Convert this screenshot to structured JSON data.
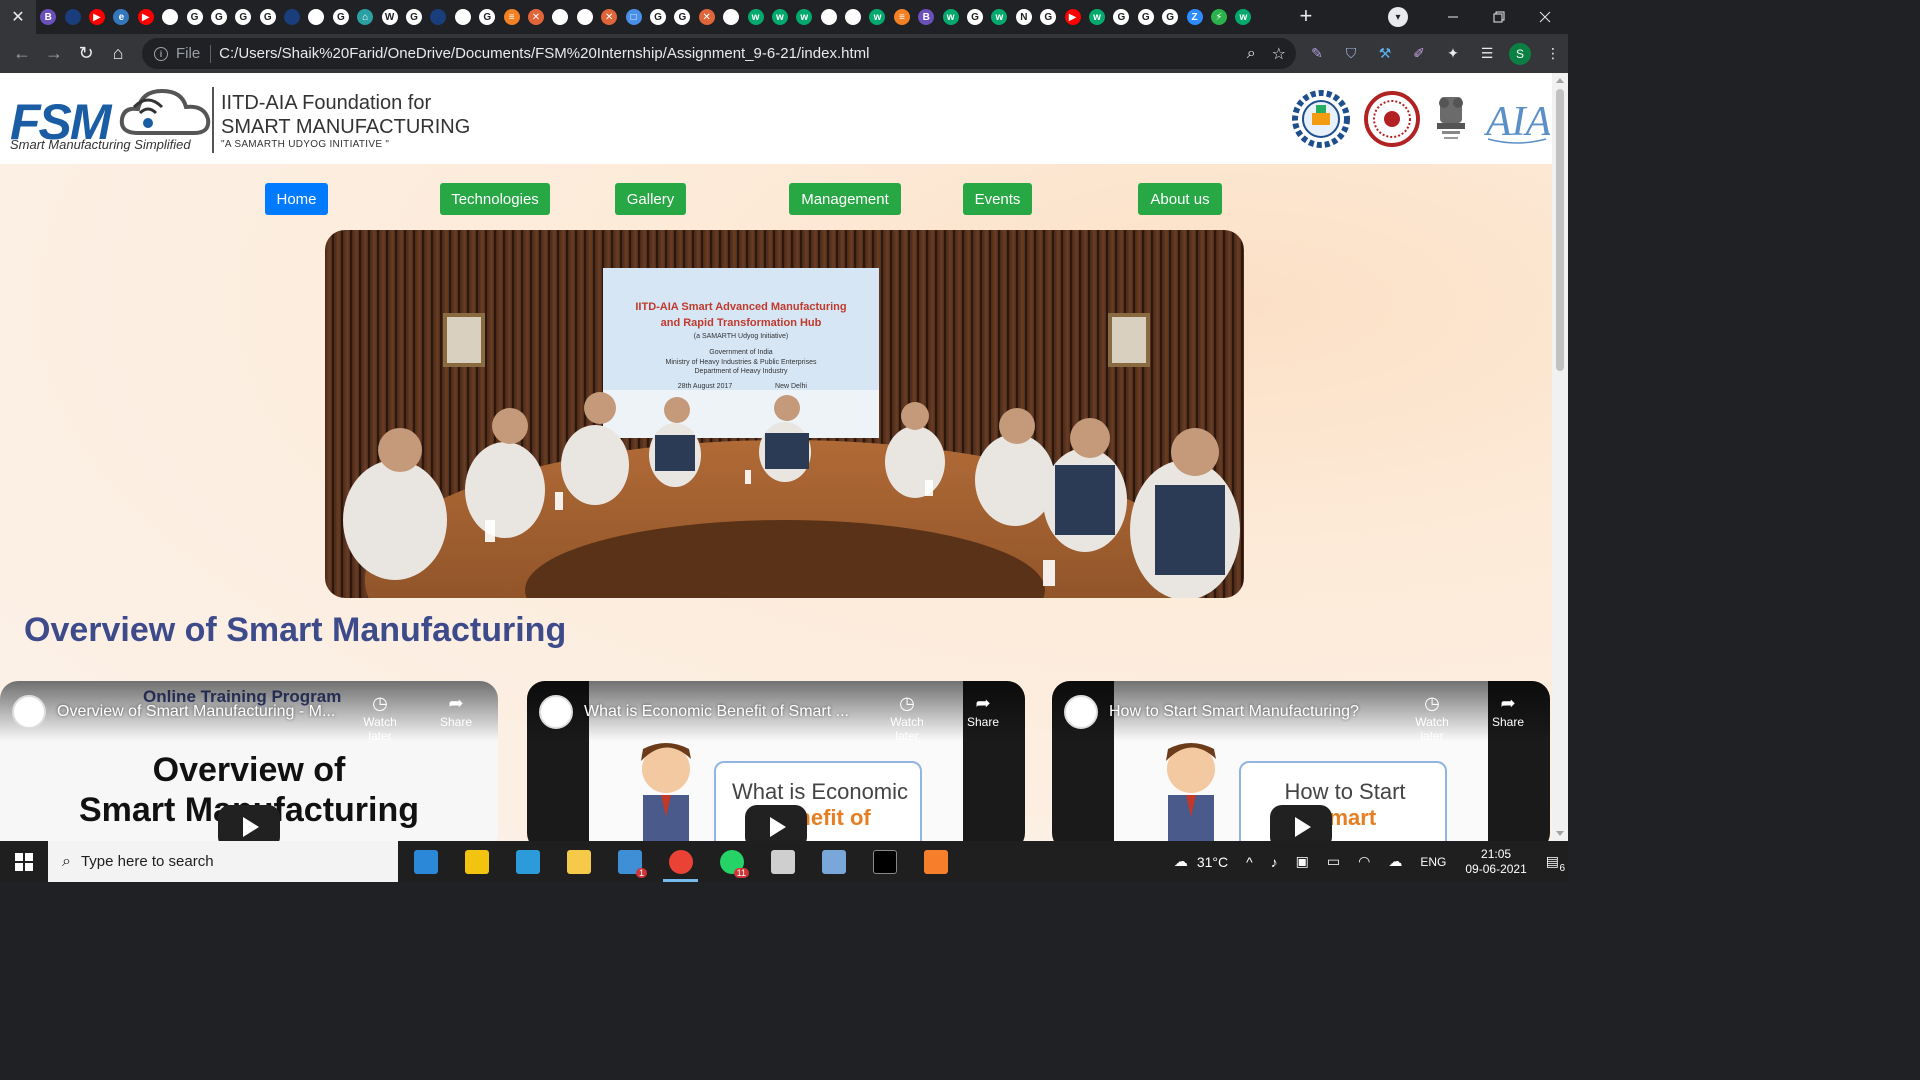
{
  "browser": {
    "tab_close_glyph": "✕",
    "new_tab_glyph": "+",
    "favicons": [
      {
        "name": "bing-favicon",
        "color": "#6b4fbb",
        "letter": "B"
      },
      {
        "name": "site-favicon",
        "color": "#1a3d7c",
        "letter": ""
      },
      {
        "name": "youtube-favicon",
        "color": "#ff0000",
        "letter": "▶"
      },
      {
        "name": "edge-favicon",
        "color": "#3277bc",
        "letter": "e"
      },
      {
        "name": "youtube-favicon",
        "color": "#ff0000",
        "letter": "▶"
      },
      {
        "name": "github-favicon",
        "color": "#ffffff",
        "letter": ""
      },
      {
        "name": "google-favicon",
        "color": "#ffffff",
        "letter": "G"
      },
      {
        "name": "google-favicon",
        "color": "#ffffff",
        "letter": "G"
      },
      {
        "name": "google-favicon",
        "color": "#ffffff",
        "letter": "G"
      },
      {
        "name": "google-favicon",
        "color": "#ffffff",
        "letter": "G"
      },
      {
        "name": "site-favicon",
        "color": "#1a3d7c",
        "letter": ""
      },
      {
        "name": "github-favicon",
        "color": "#ffffff",
        "letter": ""
      },
      {
        "name": "google-favicon",
        "color": "#ffffff",
        "letter": "G"
      },
      {
        "name": "bank-favicon",
        "color": "#2aa0a4",
        "letter": "⌂"
      },
      {
        "name": "wordpress-favicon",
        "color": "#ffffff",
        "letter": "W"
      },
      {
        "name": "google-favicon",
        "color": "#ffffff",
        "letter": "G"
      },
      {
        "name": "site-favicon",
        "color": "#1a3d7c",
        "letter": ""
      },
      {
        "name": "github-favicon",
        "color": "#ffffff",
        "letter": ""
      },
      {
        "name": "google-favicon",
        "color": "#ffffff",
        "letter": "G"
      },
      {
        "name": "stackoverflow-favicon",
        "color": "#f48024",
        "letter": "≡"
      },
      {
        "name": "tools-favicon",
        "color": "#e0663a",
        "letter": "✕"
      },
      {
        "name": "github-favicon",
        "color": "#ffffff",
        "letter": ""
      },
      {
        "name": "github-favicon",
        "color": "#ffffff",
        "letter": ""
      },
      {
        "name": "tools-favicon",
        "color": "#e0663a",
        "letter": "✕"
      },
      {
        "name": "site-favicon",
        "color": "#4a8fe7",
        "letter": "□"
      },
      {
        "name": "google-favicon",
        "color": "#ffffff",
        "letter": "G"
      },
      {
        "name": "google-favicon",
        "color": "#ffffff",
        "letter": "G"
      },
      {
        "name": "tools-favicon",
        "color": "#e0663a",
        "letter": "✕"
      },
      {
        "name": "github-favicon",
        "color": "#ffffff",
        "letter": ""
      },
      {
        "name": "w3schools-favicon",
        "color": "#04aa6d",
        "letter": "w"
      },
      {
        "name": "w3schools-favicon",
        "color": "#04aa6d",
        "letter": "w"
      },
      {
        "name": "w3schools-favicon",
        "color": "#04aa6d",
        "letter": "w"
      },
      {
        "name": "github-favicon",
        "color": "#ffffff",
        "letter": ""
      },
      {
        "name": "github-favicon",
        "color": "#ffffff",
        "letter": ""
      },
      {
        "name": "w3schools-favicon",
        "color": "#04aa6d",
        "letter": "w"
      },
      {
        "name": "stackoverflow-favicon",
        "color": "#f48024",
        "letter": "≡"
      },
      {
        "name": "bing-favicon",
        "color": "#6b4fbb",
        "letter": "B"
      },
      {
        "name": "w3schools-favicon",
        "color": "#04aa6d",
        "letter": "w"
      },
      {
        "name": "google-favicon",
        "color": "#ffffff",
        "letter": "G"
      },
      {
        "name": "w3schools-favicon",
        "color": "#04aa6d",
        "letter": "w"
      },
      {
        "name": "notion-favicon",
        "color": "#ffffff",
        "letter": "N"
      },
      {
        "name": "google-favicon",
        "color": "#ffffff",
        "letter": "G"
      },
      {
        "name": "youtube-favicon",
        "color": "#ff0000",
        "letter": "▶"
      },
      {
        "name": "w3schools-favicon",
        "color": "#04aa6d",
        "letter": "w"
      },
      {
        "name": "google-favicon",
        "color": "#ffffff",
        "letter": "G"
      },
      {
        "name": "google-favicon",
        "color": "#ffffff",
        "letter": "G"
      },
      {
        "name": "google-favicon",
        "color": "#ffffff",
        "letter": "G"
      },
      {
        "name": "zoom-favicon",
        "color": "#2d8cff",
        "letter": "Z"
      },
      {
        "name": "site-favicon",
        "color": "#2bb24c",
        "letter": "⚡"
      },
      {
        "name": "w3schools-favicon",
        "color": "#04aa6d",
        "letter": "w"
      },
      {
        "name": "site-favicon",
        "color": "#202124",
        "letter": ""
      }
    ],
    "address": {
      "scheme_label": "File",
      "url": "C:/Users/Shaik%20Farid/OneDrive/Documents/FSM%20Internship/Assignment_9-6-21/index.html"
    },
    "profile_initial": "S"
  },
  "site": {
    "logo_text": "FSM",
    "logo_tagline": "Smart Manufacturing Simplified",
    "foundation_line1": "IITD-AIA Foundation for",
    "foundation_line2": "SMART MANUFACTURING",
    "foundation_line3": "\"A SAMARTH UDYOG INITIATIVE \"",
    "nav": [
      {
        "label": "Home",
        "style": "blue"
      },
      {
        "label": "Technologies",
        "style": "green"
      },
      {
        "label": "Gallery",
        "style": "green"
      },
      {
        "label": "Management",
        "style": "green"
      },
      {
        "label": "Events",
        "style": "green"
      },
      {
        "label": "About us",
        "style": "green"
      }
    ],
    "hero_banner_lines": [
      "IITD-AIA Smart Advanced Manufacturing",
      "and Rapid Transformation Hub",
      "(a SAMARTH Udyog Initiative)",
      "Government of India",
      "Ministry of Heavy Industries & Public Enterprises",
      "Department of Heavy Industry",
      "28th August 2017",
      "New Delhi"
    ],
    "section_title": "Overview of Smart Manufacturing",
    "videos": [
      {
        "title": "Overview of Smart Manufacturing - M...",
        "overlay_top": "Online Training Program",
        "thumb_line1": "Overview of",
        "thumb_line2": "Smart Manufacturing",
        "watch_later": "Watch later",
        "share": "Share"
      },
      {
        "title": "What is Economic Benefit of Smart ...",
        "thumb_line1": "What is Economic",
        "thumb_line2": "Benefit of",
        "watch_later": "Watch later",
        "share": "Share"
      },
      {
        "title": "How to Start Smart Manufacturing?",
        "thumb_line1": "How to Start",
        "thumb_line2": "Smart",
        "watch_later": "Watch later",
        "share": "Share"
      }
    ]
  },
  "taskbar": {
    "search_placeholder": "Type here to search",
    "apps": [
      {
        "name": "edge",
        "color": "#2b88d9",
        "badge": ""
      },
      {
        "name": "store",
        "color": "#f2c40f",
        "badge": ""
      },
      {
        "name": "vscode",
        "color": "#2b9bd9",
        "badge": ""
      },
      {
        "name": "file-explorer",
        "color": "#f7c948",
        "badge": ""
      },
      {
        "name": "mail",
        "color": "#3f8fd6",
        "badge": "1"
      },
      {
        "name": "chrome",
        "color": "#ea4335",
        "badge": ""
      },
      {
        "name": "whatsapp",
        "color": "#25d366",
        "badge": "11"
      },
      {
        "name": "settings",
        "color": "#cfcfcf",
        "badge": ""
      },
      {
        "name": "postgres",
        "color": "#7aa7d9",
        "badge": ""
      },
      {
        "name": "terminal",
        "color": "#000000",
        "badge": ""
      },
      {
        "name": "sublime",
        "color": "#f77f2b",
        "badge": ""
      }
    ],
    "weather": "31°C",
    "language": "ENG",
    "time": "21:05",
    "date": "09-06-2021",
    "notification_count": "6"
  }
}
